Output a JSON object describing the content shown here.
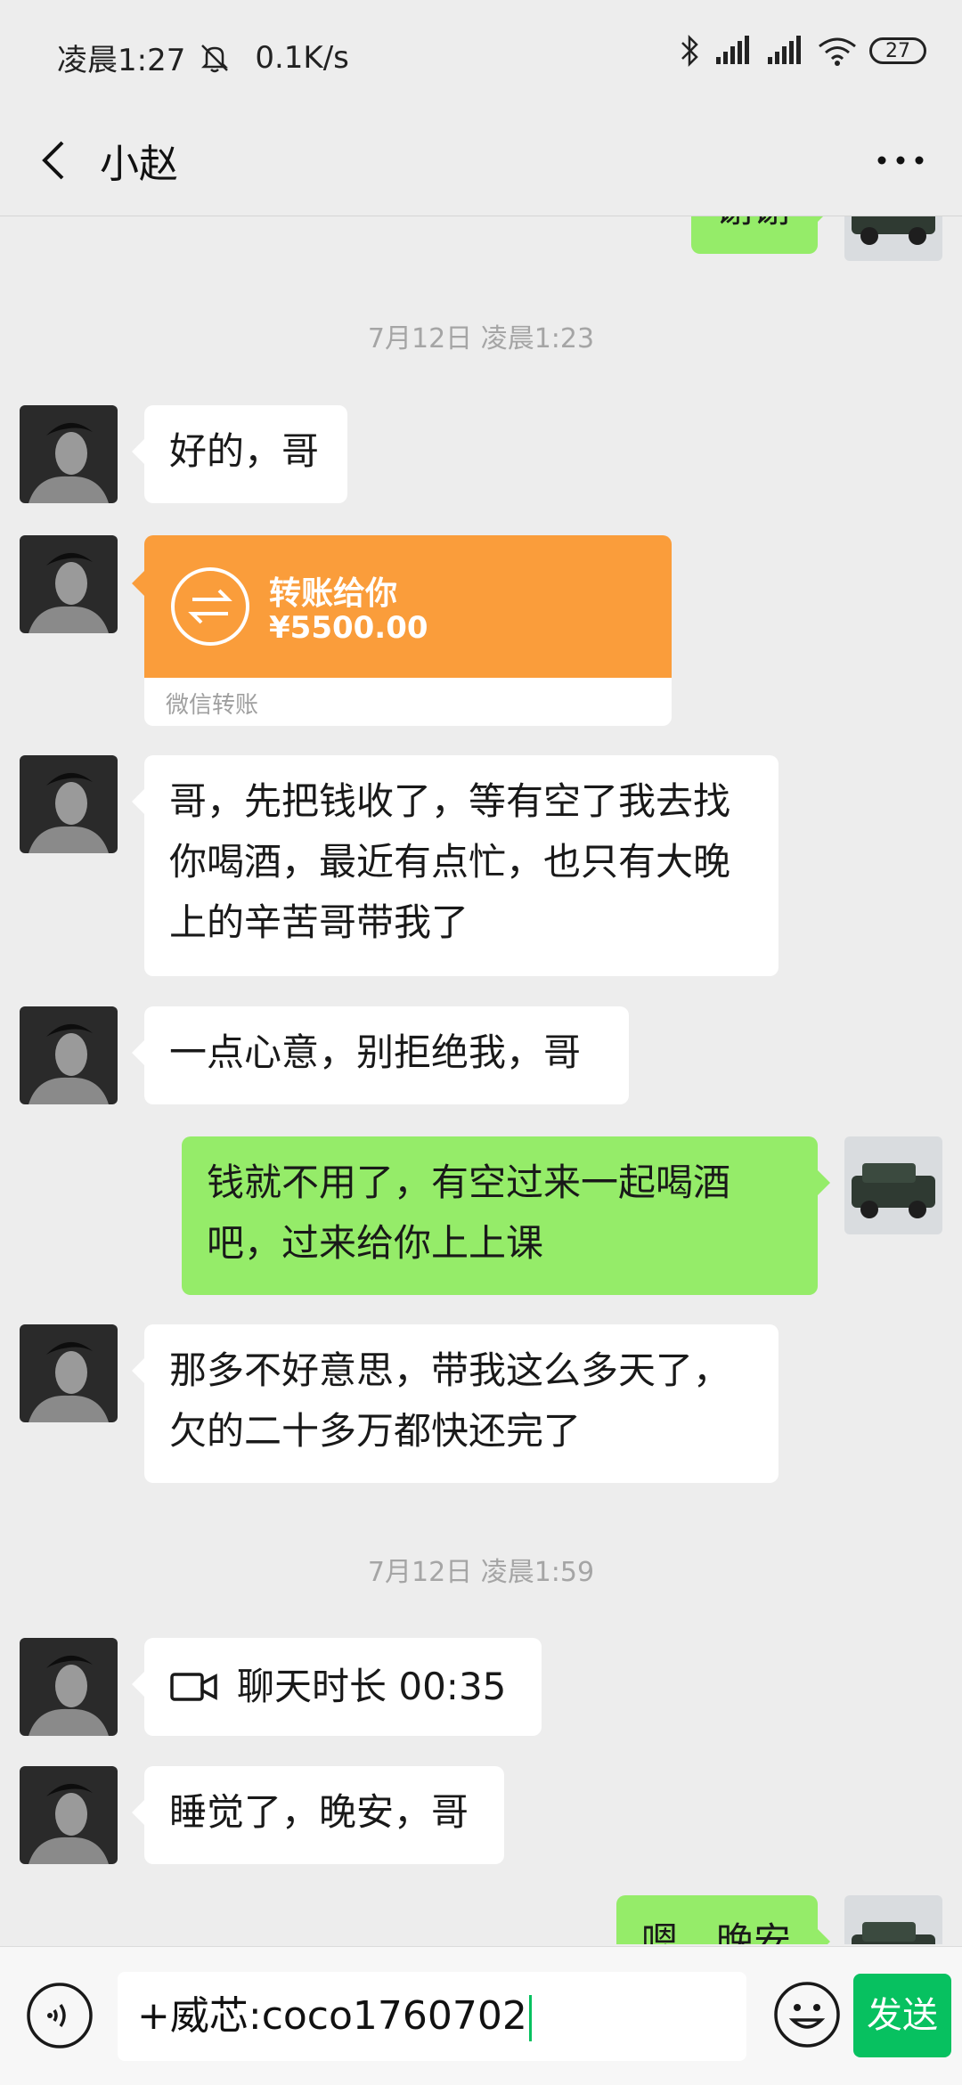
{
  "status_bar": {
    "time": "凌晨1:27",
    "speed": "0.1K/s",
    "battery": "27"
  },
  "nav": {
    "title": "小赵"
  },
  "messages": {
    "top_partial": "谢谢",
    "ts1": "7月12日 凌晨1:23",
    "m1": "好的，哥",
    "transfer_title": "转账给你",
    "transfer_amount": "¥5500.00",
    "transfer_label": "微信转账",
    "m2_l1": "哥，先把钱收了，等有空了我去找",
    "m2_l2": "你喝酒，最近有点忙，也只有大晚",
    "m2_l3": "上的辛苦哥带我了",
    "m3": "一点心意，别拒绝我，哥",
    "m4_l1": "钱就不用了，有空过来一起喝酒",
    "m4_l2": "吧，过来给你上上课",
    "m5_l1": "那多不好意思，带我这么多天了，",
    "m5_l2": "欠的二十多万都快还完了",
    "ts2": "7月12日 凌晨1:59",
    "call": "聊天时长 00:35",
    "m6": "睡觉了，晚安，哥",
    "m7_partial": "嗯，晚安"
  },
  "input": {
    "value": "+威芯:coco1760702",
    "send_label": "发送"
  },
  "colors": {
    "accent": "#07c160",
    "sent_bubble": "#95ec69",
    "transfer": "#fa9d3b"
  }
}
